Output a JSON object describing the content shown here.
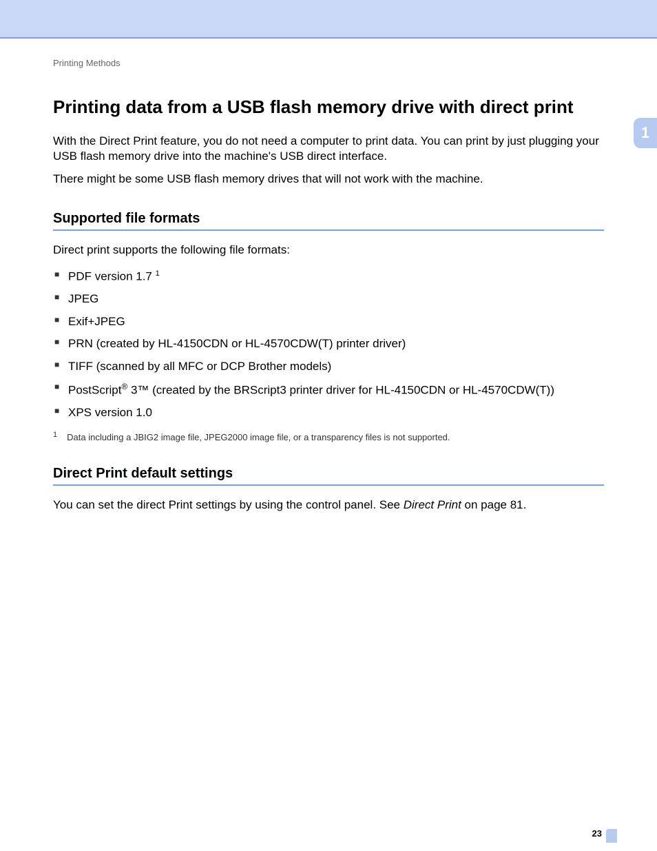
{
  "breadcrumb": "Printing Methods",
  "chapter_tab": "1",
  "title": "Printing data from a USB flash memory drive with direct print",
  "intro1": "With the Direct Print feature, you do not need a computer to print data. You can print by just plugging your USB flash memory drive into the machine's USB direct interface.",
  "intro2": "There might be some USB flash memory drives that will not work with the machine.",
  "section1": {
    "heading": "Supported file formats",
    "lead": "Direct print supports the following file formats:",
    "items": {
      "i0_pre": "PDF version 1.7",
      "i0_sup": "1",
      "i1": "JPEG",
      "i2": "Exif+JPEG",
      "i3": "PRN (created by HL-4150CDN or HL-4570CDW(T) printer driver)",
      "i4": "TIFF (scanned by all MFC or DCP Brother models)",
      "i5_pre": "PostScript",
      "i5_reg": "®",
      "i5_post": " 3™ (created by the BRScript3 printer driver for HL-4150CDN or HL-4570CDW(T))",
      "i6": "XPS version 1.0"
    },
    "footnote_num": "1",
    "footnote_text": "Data including a JBIG2 image file, JPEG2000 image file, or a transparency files is not supported."
  },
  "section2": {
    "heading": "Direct Print default settings",
    "body_pre": "You can set the direct Print settings by using the control panel. See ",
    "body_link": "Direct Print",
    "body_post": " on page 81."
  },
  "page_number": "23"
}
